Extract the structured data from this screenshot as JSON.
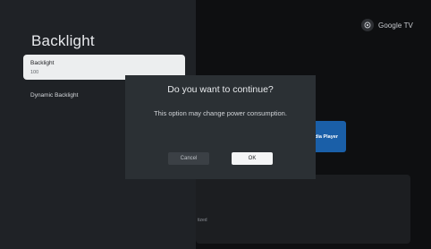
{
  "brand": {
    "name": "Google TV",
    "icon": "google-tv-logo-icon"
  },
  "background": {
    "tile_label": "dia Player",
    "card_text": "tized"
  },
  "settings_panel": {
    "title": "Backlight",
    "items": [
      {
        "label": "Backlight",
        "value": "100",
        "selected": true
      },
      {
        "label": "Dynamic Backlight"
      }
    ]
  },
  "dialog": {
    "title": "Do you want to continue?",
    "message": "This option may change power consumption.",
    "cancel_label": "Cancel",
    "ok_label": "OK"
  },
  "colors": {
    "panel_bg": "#1f2226",
    "dialog_bg": "#2b3034",
    "selected_item_bg": "#eceeef",
    "tile_blue": "#1a5fa8"
  }
}
